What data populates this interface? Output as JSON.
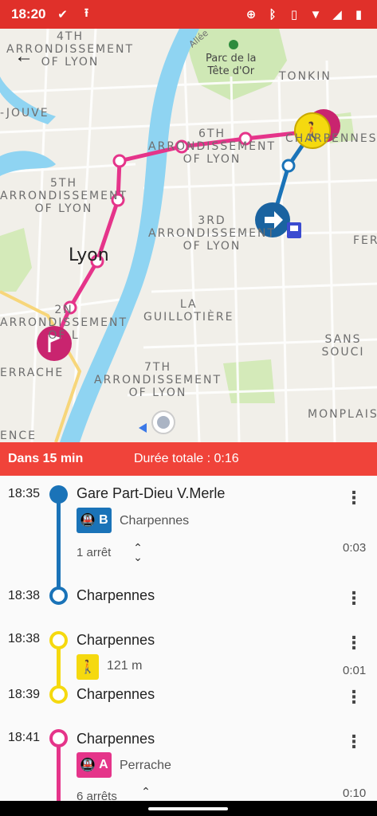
{
  "status_bar": {
    "time": "18:20",
    "left_icons": [
      "done-all-icon",
      "upload-icon"
    ],
    "right_icons": [
      "alarm-icon",
      "bluetooth-icon",
      "vibrate-icon",
      "wifi-icon",
      "signal-icon",
      "battery-icon"
    ]
  },
  "map": {
    "labels": {
      "arr4": "4TH\nARRONDISSEMENT\nOF LYON",
      "park": "Parc de la\nTête d'Or",
      "tonkin": "TONKIN",
      "jouve": "-JOUVE",
      "arr6": "6TH\nARRONDISSEMENT\nOF LYON",
      "charpennes": "CHARPENNES",
      "arr5": "5TH\nARRONDISSEMENT\nOF LYON",
      "arr3": "3RD\nARRONDISSEMENT\nOF LYON",
      "fer": "FER",
      "lyon": "Lyon",
      "arr2": "2N\nARRONDISSEMENT\nOF L",
      "guillotiere": "LA\nGUILLOTIÈRE",
      "sans_souci": "SANS SOUCI",
      "perrache": "ERRACHE",
      "arr7": "7TH\nARRONDISSEMENT\nOF LYON",
      "monplaisir": "MONPLAISIR",
      "ence": "ENCE",
      "allee": "Allée"
    },
    "colors": {
      "metro_b": "#1a73b8",
      "metro_a": "#e5348a",
      "walk": "#f5d90f",
      "river": "#8fd4f2",
      "park": "#cfe8b5"
    }
  },
  "summary": {
    "eta": "Dans 15 min",
    "total": "Durée totale : 0:16"
  },
  "itinerary": {
    "leg1": {
      "dep_time": "18:35",
      "dep_stop": "Gare Part-Dieu V.Merle",
      "line": "B",
      "line_icon": "metro-icon",
      "direction": "Charpennes",
      "stops": "1 arrêt",
      "duration": "0:03",
      "arr_time": "18:38",
      "arr_stop": "Charpennes"
    },
    "leg2": {
      "dep_time": "18:38",
      "dep_stop": "Charpennes",
      "walk_icon": "walk-icon",
      "distance": "121 m",
      "duration": "0:01",
      "arr_time": "18:39",
      "arr_stop": "Charpennes"
    },
    "leg3": {
      "dep_time": "18:41",
      "dep_stop": "Charpennes",
      "line": "A",
      "line_icon": "metro-icon",
      "direction": "Perrache",
      "stops": "6 arrêts",
      "duration": "0:10"
    }
  }
}
